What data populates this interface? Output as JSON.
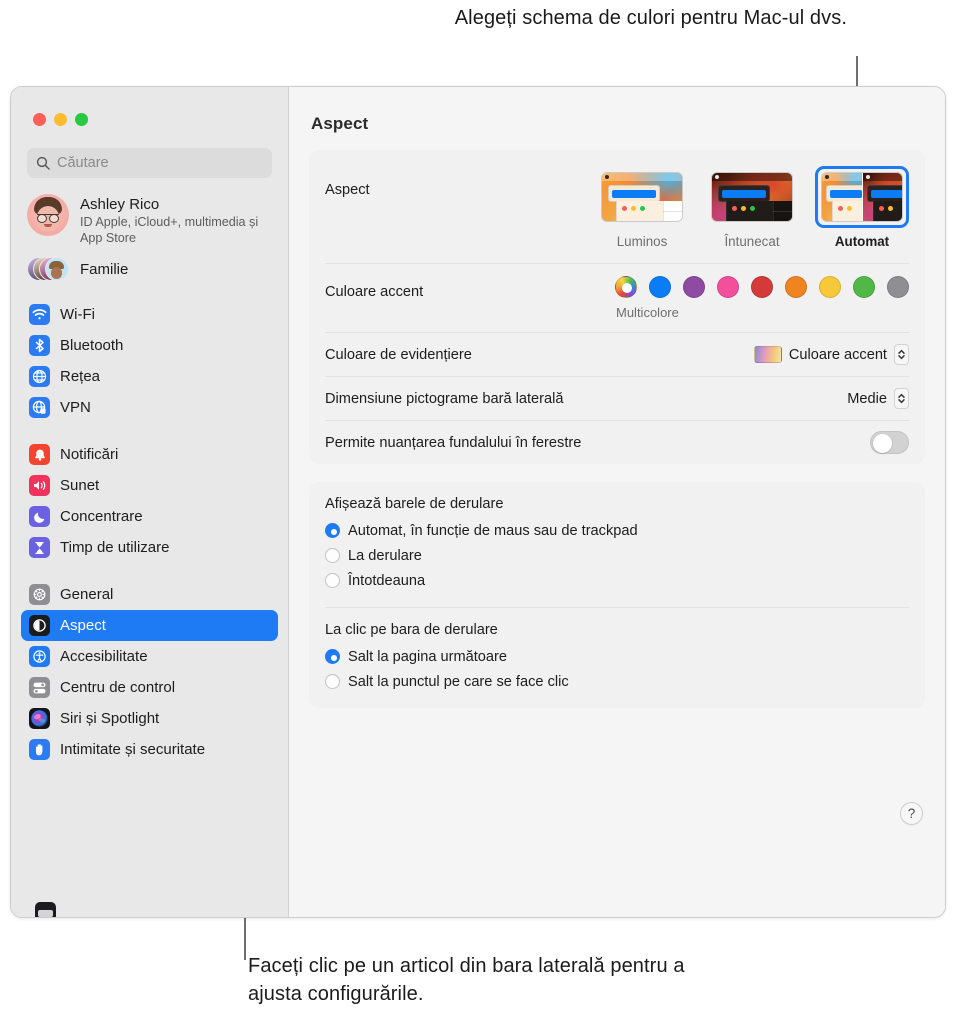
{
  "annotations": {
    "top": "Alegeți schema de culori pentru Mac-ul dvs.",
    "bottom": "Faceți clic pe un articol din bara laterală pentru a ajusta configurările."
  },
  "window": {
    "traffic_lights": [
      "close",
      "minimize",
      "zoom"
    ]
  },
  "sidebar": {
    "search": {
      "placeholder": "Căutare",
      "value": "",
      "icon": "search-icon"
    },
    "account": {
      "name": "Ashley Rico",
      "subtitle": "ID Apple, iCloud+, multimedia și App Store"
    },
    "family": {
      "label": "Familie"
    },
    "groups": [
      {
        "items": [
          {
            "label": "Wi-Fi",
            "icon": "wifi-icon",
            "color": "#2b7bf3"
          },
          {
            "label": "Bluetooth",
            "icon": "bluetooth-icon",
            "color": "#2b7bf3"
          },
          {
            "label": "Rețea",
            "icon": "globe-icon",
            "color": "#2b7bf3"
          },
          {
            "label": "VPN",
            "icon": "vpn-globe-icon",
            "color": "#2b7bf3"
          }
        ]
      },
      {
        "items": [
          {
            "label": "Notificări",
            "icon": "bell-icon",
            "color": "#f4432f"
          },
          {
            "label": "Sunet",
            "icon": "speaker-icon",
            "color": "#f0325c"
          },
          {
            "label": "Concentrare",
            "icon": "moon-icon",
            "color": "#6a62e0"
          },
          {
            "label": "Timp de utilizare",
            "icon": "hourglass-icon",
            "color": "#6a62e0"
          }
        ]
      },
      {
        "items": [
          {
            "label": "General",
            "icon": "gear-icon",
            "color": "#8e8e93"
          },
          {
            "label": "Aspect",
            "icon": "appearance-icon",
            "color": "#1c1c1e",
            "selected": true
          },
          {
            "label": "Accesibilitate",
            "icon": "accessibility-icon",
            "color": "#1f7bf4"
          },
          {
            "label": "Centru de control",
            "icon": "control-center-icon",
            "color": "#8e8e93"
          },
          {
            "label": "Siri și Spotlight",
            "icon": "siri-icon",
            "color": "#1c1c1e"
          },
          {
            "label": "Intimitate și securitate",
            "icon": "hand-icon",
            "color": "#2b7bf3"
          }
        ]
      }
    ]
  },
  "detail": {
    "title": "Aspect",
    "appearance": {
      "label": "Aspect",
      "options": [
        {
          "label": "Luminos",
          "mode": "light",
          "selected": false
        },
        {
          "label": "Întunecat",
          "mode": "dark",
          "selected": false
        },
        {
          "label": "Automat",
          "mode": "auto",
          "selected": true
        }
      ]
    },
    "accent": {
      "label": "Culoare accent",
      "caption": "Multicolore",
      "swatches": [
        {
          "name": "multicolor",
          "color": "multicolor"
        },
        {
          "name": "blue",
          "color": "#0a7cf5"
        },
        {
          "name": "purple",
          "color": "#8e4ba1"
        },
        {
          "name": "pink",
          "color": "#f2509b"
        },
        {
          "name": "red",
          "color": "#d43a3a"
        },
        {
          "name": "orange",
          "color": "#ef8420"
        },
        {
          "name": "yellow",
          "color": "#f7c93a"
        },
        {
          "name": "green",
          "color": "#51b848"
        },
        {
          "name": "graphite",
          "color": "#8e8e93"
        }
      ],
      "selected": "multicolor"
    },
    "highlight": {
      "label": "Culoare de evidențiere",
      "value": "Culoare accent"
    },
    "sidebar_icon_size": {
      "label": "Dimensiune pictograme bară laterală",
      "value": "Medie"
    },
    "wallpaper_tinting": {
      "label": "Permite nuanțarea fundalului în ferestre",
      "enabled": false
    },
    "show_scroll_bars": {
      "title": "Afișează barele de derulare",
      "options": [
        {
          "label": "Automat, în funcție de maus sau de trackpad",
          "selected": true
        },
        {
          "label": "La derulare",
          "selected": false
        },
        {
          "label": "Întotdeauna",
          "selected": false
        }
      ]
    },
    "click_scroll_bar": {
      "title": "La clic pe bara de derulare",
      "options": [
        {
          "label": "Salt la pagina următoare",
          "selected": true
        },
        {
          "label": "Salt la punctul pe care se face clic",
          "selected": false
        }
      ]
    },
    "help": {
      "label": "?"
    }
  }
}
